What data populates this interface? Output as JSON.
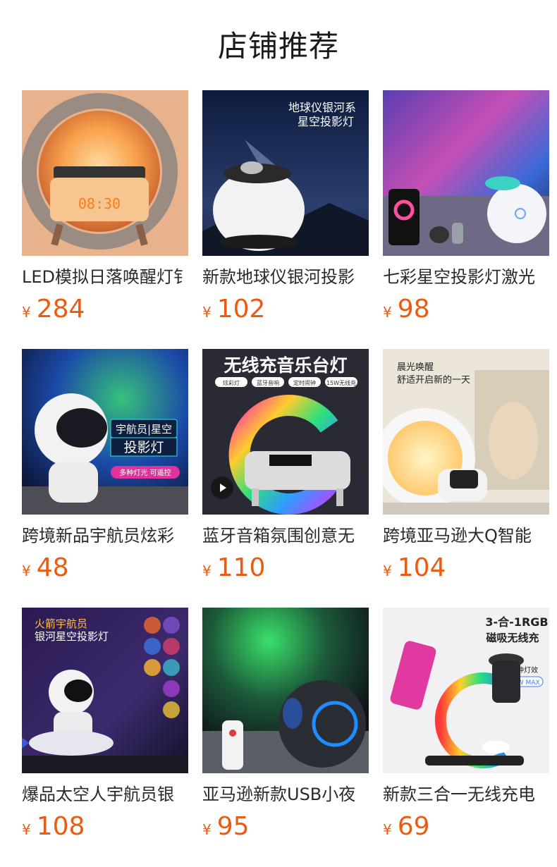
{
  "section": {
    "title": "店铺推荐"
  },
  "products": [
    {
      "name": "LED模拟日落唤醒灯钅",
      "currency": "¥",
      "price": "284",
      "image_text": []
    },
    {
      "name": "新款地球仪银河投影",
      "currency": "¥",
      "price": "102",
      "image_text": [
        "地球仪银河系",
        "星空投影灯"
      ]
    },
    {
      "name": "七彩星空投影灯激光",
      "currency": "¥",
      "price": "98",
      "image_text": []
    },
    {
      "name": "跨境新品宇航员炫彩",
      "currency": "¥",
      "price": "48",
      "image_text": [
        "宇航员|星空",
        "投影灯",
        "多种灯光  可遥控"
      ]
    },
    {
      "name": "蓝牙音箱氛围创意无",
      "currency": "¥",
      "price": "110",
      "image_text": [
        "无线充音乐台灯",
        "炫彩灯",
        "蓝牙音响",
        "定时闹钟",
        "15W无线充"
      ]
    },
    {
      "name": "跨境亚马逊大Q智能",
      "currency": "¥",
      "price": "104",
      "image_text": [
        "晨光唤醒",
        "舒适开启新的一天"
      ]
    },
    {
      "name": "爆品太空人宇航员银",
      "currency": "¥",
      "price": "108",
      "image_text": [
        "火箭宇航员",
        "银河星空投影灯"
      ]
    },
    {
      "name": "亚马逊新款USB小夜",
      "currency": "¥",
      "price": "95",
      "image_text": []
    },
    {
      "name": "新款三合一无线充电",
      "currency": "¥",
      "price": "69",
      "image_text": [
        "3-合-1RGB",
        "磁吸无线充",
        "六种灯效",
        "15W MAX"
      ]
    }
  ]
}
